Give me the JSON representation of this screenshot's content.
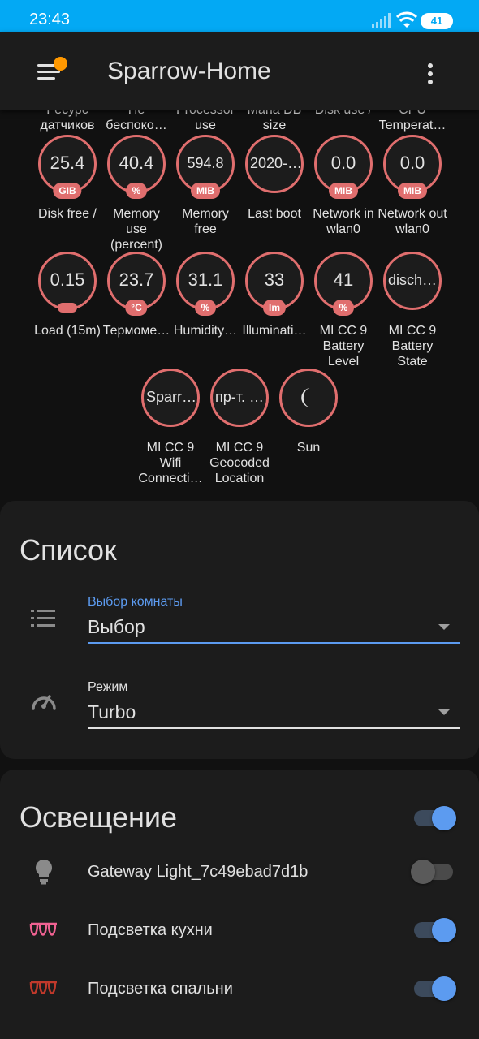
{
  "status_bar": {
    "time": "23:43",
    "battery": "41"
  },
  "app_bar": {
    "title": "Sparrow-Home"
  },
  "badges": {
    "row0": [
      {
        "label": "Ресурс датчиков"
      },
      {
        "label": "Не беспоко…"
      },
      {
        "label": "Processor use"
      },
      {
        "label": "Maria DB size"
      },
      {
        "label": "Disk use /"
      },
      {
        "label": "CPU Temperat…"
      }
    ],
    "row1": [
      {
        "value": "25.4",
        "unit": "GIB",
        "label": "Disk free /"
      },
      {
        "value": "40.4",
        "unit": "%",
        "label": "Memory use (percent)"
      },
      {
        "value": "594.8",
        "unit": "MIB",
        "label": "Memory free"
      },
      {
        "value": "2020-…",
        "unit": "",
        "label": "Last boot"
      },
      {
        "value": "0.0",
        "unit": "MIB",
        "label": "Network in wlan0"
      },
      {
        "value": "0.0",
        "unit": "MIB",
        "label": "Network out wlan0"
      }
    ],
    "row2": [
      {
        "value": "0.15",
        "unit": "",
        "label": "Load (15m)"
      },
      {
        "value": "23.7",
        "unit": "°C",
        "label": "Термоме…"
      },
      {
        "value": "31.1",
        "unit": "%",
        "label": "Humidity…"
      },
      {
        "value": "33",
        "unit": "lm",
        "label": "Illuminati…"
      },
      {
        "value": "41",
        "unit": "%",
        "label": "MI CC 9 Battery Level"
      },
      {
        "value": "disch…",
        "unit": "",
        "label": "MI CC 9 Battery State"
      }
    ],
    "row3": [
      {
        "value": "Sparr…",
        "label": "MI CC 9 Wifi Connecti…"
      },
      {
        "value": "пр-т. …",
        "label": "MI CC 9 Geocoded Location"
      },
      {
        "icon": "moon-icon",
        "label": "Sun"
      }
    ]
  },
  "list_card": {
    "title": "Список",
    "room_select": {
      "label": "Выбор комнаты",
      "value": "Выбор"
    },
    "mode_select": {
      "label": "Режим",
      "value": "Turbo"
    }
  },
  "lights_card": {
    "title": "Освещение",
    "master_on": true,
    "rows": [
      {
        "label": "Gateway Light_7c49ebad7d1b",
        "icon": "lightbulb-icon",
        "on": false
      },
      {
        "label": "Подсветка кухни",
        "icon": "led-strip-icon",
        "on": true
      },
      {
        "label": "Подсветка спальни",
        "icon": "led-strip-icon",
        "on": true
      }
    ]
  },
  "colors": {
    "accent": "#5c9bf0",
    "badge_ring": "#e06e6e",
    "status_bar": "#03a9f4",
    "card": "#1c1c1c",
    "background": "#111111",
    "kitchen_icon": "#f06292",
    "bedroom_icon": "#c0392b"
  }
}
